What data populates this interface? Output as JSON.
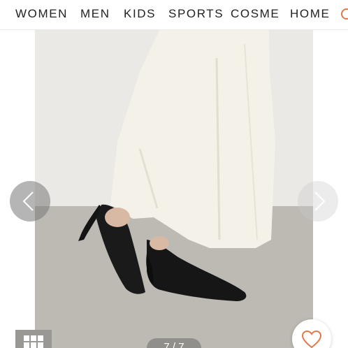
{
  "nav": {
    "items": [
      "WOMEN",
      "MEN",
      "KIDS",
      "SPORTS",
      "COSME",
      "HOME"
    ]
  },
  "gallery": {
    "counter": "7 / 7"
  },
  "icons": {
    "prev": "chevron-left-icon",
    "next": "chevron-right-icon",
    "grid": "grid-icon",
    "favorite": "heart-icon",
    "partial_nav": "partial-nav-icon"
  },
  "colors": {
    "accent": "#e07a4a",
    "text": "#222222"
  }
}
